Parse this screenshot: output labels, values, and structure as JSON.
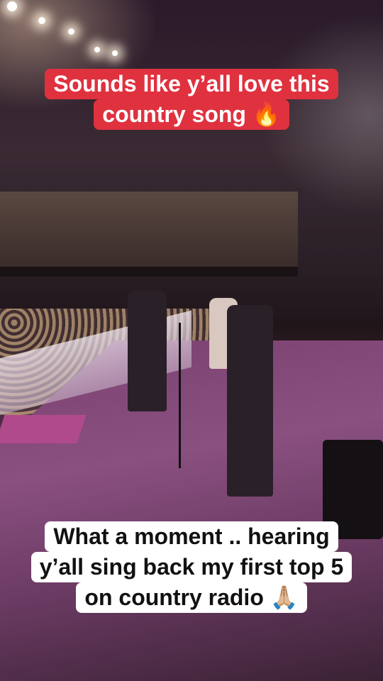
{
  "overlay_top": {
    "lines": [
      "Sounds like y’all love this",
      "country song 🔥"
    ],
    "background": "#e0313f",
    "text_color": "#ffffff"
  },
  "overlay_bottom": {
    "lines": [
      "What a moment .. hearing",
      "y’all sing back my first top 5",
      "on country radio 🙏🏼"
    ],
    "background": "#ffffff",
    "text_color": "#111111"
  },
  "scene": {
    "description_icon": "concert-stage-photo"
  }
}
